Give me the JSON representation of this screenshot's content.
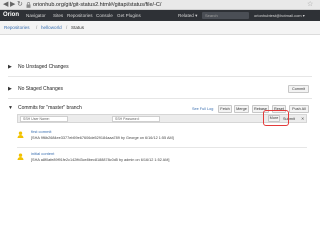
{
  "browser": {
    "url": "orionhub.org/git/git-status2.html#/gitapi/status/file/-C/",
    "back_glyph": "◀",
    "forward_glyph": "▶",
    "reload_glyph": "↻",
    "bookmark_glyph": "☆"
  },
  "topnav": {
    "logo": "Orion",
    "items": [
      "Navigator",
      "Sites",
      "Repositories",
      "Console",
      "Get Plugins"
    ],
    "related": "Related ▾",
    "search_placeholder": "Search",
    "user": "orionhubtest@hotmail.com ▾"
  },
  "breadcrumb": {
    "root": "Repositories",
    "repo": "helloworld",
    "current": "Status"
  },
  "sections": {
    "unstaged": {
      "title": "No Unstaged Changes"
    },
    "staged": {
      "title": "No Staged Changes",
      "commit_button": "Commit"
    },
    "commits": {
      "title": "Commits for \"master\" branch",
      "see_full_log": "See Full Log",
      "buttons": {
        "fetch": "Fetch",
        "merge": "Merge",
        "rebase": "Rebase",
        "reset": "Reset",
        "push_all": "Push All"
      }
    }
  },
  "filter": {
    "user_name_placeholder": "SSH User Name:",
    "password_placeholder": "SSH Password:",
    "more_button": "More",
    "submit_button": "Submit",
    "close_glyph": "✕"
  },
  "commits": [
    {
      "title": "first commit",
      "meta": "[SHA 9f6b2684ee3377eb59e67606de529184aaa789 by George on 6/16/12 1:55 AM]"
    },
    {
      "title": "initial content",
      "meta": "[SHA a8f0afe89f91fe2c142ffd3ce8bec8188878c0d5 by admin on 6/16/12 1:52 AM]"
    }
  ],
  "colors": {
    "nav_background": "#2e3136",
    "link": "#3a6fb0",
    "highlight": "#e33b3b",
    "commit_icon": "#f2c200"
  }
}
